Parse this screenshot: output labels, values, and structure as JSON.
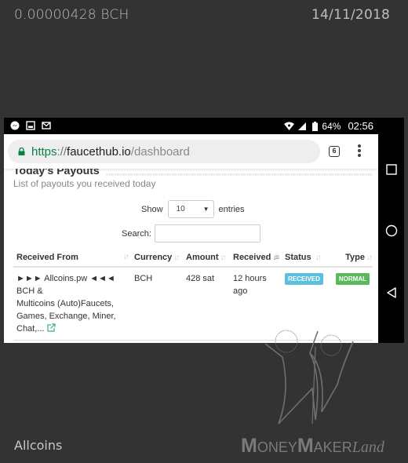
{
  "overlay": {
    "amount": "0.00000428 BCH",
    "date": "14/11/2018",
    "faucet_name": "Allcoins",
    "brand": {
      "m1": "M",
      "oney": "ONEY",
      "m2": "M",
      "aker": "AKER",
      "land": "Land"
    }
  },
  "statusbar": {
    "notification_icons": [
      "messenger-icon",
      "image-icon",
      "gmail-icon"
    ],
    "battery": "64%",
    "time": "02:56"
  },
  "browser": {
    "url_scheme": "https",
    "url_sep": "://",
    "url_host": "faucethub.io",
    "url_path": "/dashboard",
    "tab_count": "6"
  },
  "page": {
    "title": "Today's Payouts",
    "subtitle": "List of payouts you received today",
    "show_label": "Show",
    "entries_value": "10",
    "entries_label": "entries",
    "search_label": "Search:",
    "search_value": ""
  },
  "table": {
    "columns": [
      {
        "label": "Received From",
        "sort": "none"
      },
      {
        "label": "Currency",
        "sort": "none"
      },
      {
        "label": "Amount",
        "sort": "none"
      },
      {
        "label": "Received",
        "sort": "desc"
      },
      {
        "label": "Status",
        "sort": "none"
      },
      {
        "label": "Type",
        "sort": "none"
      }
    ],
    "rows": [
      {
        "from_line1": "►►► Allcoins.pw ◄◄◄",
        "from_line2": "BCH &",
        "from_line3": "Multicoins (Auto)Faucets,",
        "from_line4": "Games, Exchange, Miner,",
        "from_line5": "Chat,...",
        "currency": "BCH",
        "amount": "428 sat",
        "received": "12 hours ago",
        "status": "RECEIVED",
        "type": "NORMAL"
      }
    ]
  },
  "colors": {
    "status_received": "#5bc0de",
    "type_normal": "#5cb85c",
    "secure_green": "#0b8043",
    "background": "#333333"
  }
}
